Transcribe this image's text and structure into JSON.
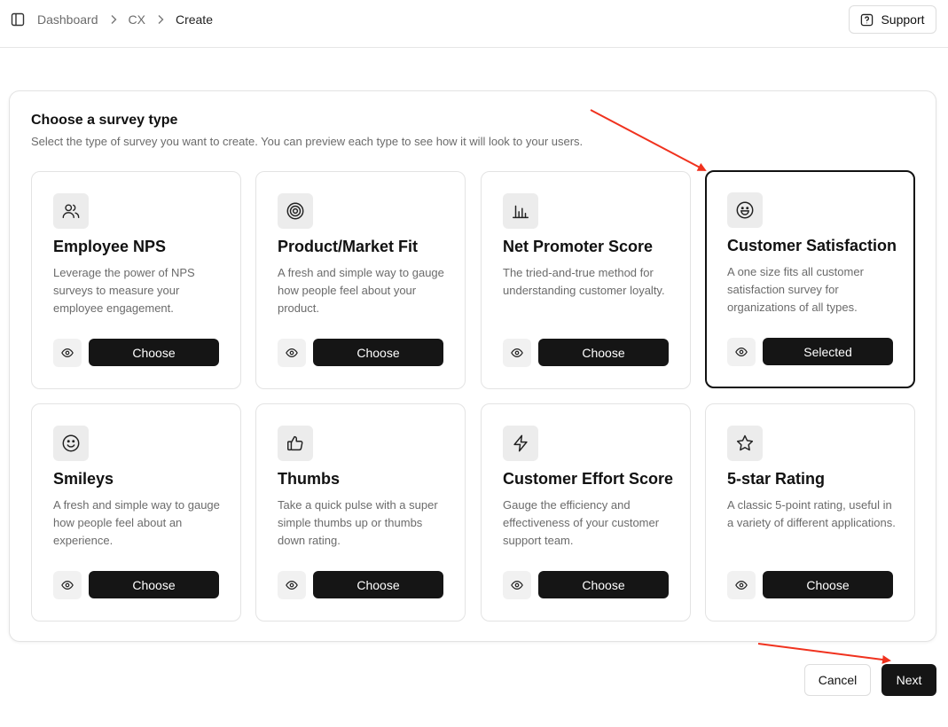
{
  "breadcrumb": {
    "items": [
      "Dashboard",
      "CX",
      "Create"
    ]
  },
  "header": {
    "support_label": "Support"
  },
  "panel": {
    "title": "Choose a survey type",
    "subtitle": "Select the type of survey you want to create. You can preview each type to see how it will look to your users."
  },
  "cards": [
    {
      "title": "Employee NPS",
      "description": "Leverage the power of NPS surveys to measure your employee engagement.",
      "button_label": "Choose",
      "icon": "users-icon",
      "selected": false
    },
    {
      "title": "Product/Market Fit",
      "description": "A fresh and simple way to gauge how people feel about your product.",
      "button_label": "Choose",
      "icon": "target-icon",
      "selected": false
    },
    {
      "title": "Net Promoter Score",
      "description": "The tried-and-true method for understanding customer loyalty.",
      "button_label": "Choose",
      "icon": "bar-chart-icon",
      "selected": false
    },
    {
      "title": "Customer Satisfaction",
      "description": "A one size fits all customer satisfaction survey for organizations of all types.",
      "button_label": "Selected",
      "icon": "grin-icon",
      "selected": true
    },
    {
      "title": "Smileys",
      "description": "A fresh and simple way to gauge how people feel about an experience.",
      "button_label": "Choose",
      "icon": "smile-icon",
      "selected": false
    },
    {
      "title": "Thumbs",
      "description": "Take a quick pulse with a super simple thumbs up or thumbs down rating.",
      "button_label": "Choose",
      "icon": "thumbs-up-icon",
      "selected": false
    },
    {
      "title": "Customer Effort Score",
      "description": "Gauge the efficiency and effectiveness of your customer support team.",
      "button_label": "Choose",
      "icon": "lightning-icon",
      "selected": false
    },
    {
      "title": "5-star Rating",
      "description": "A classic 5-point rating, useful in a variety of different applications.",
      "button_label": "Choose",
      "icon": "star-icon",
      "selected": false
    }
  ],
  "footer": {
    "cancel_label": "Cancel",
    "next_label": "Next"
  },
  "colors": {
    "primary_button": "#151515",
    "annotation_arrow": "#f0321e",
    "selected_border": "#111111"
  }
}
